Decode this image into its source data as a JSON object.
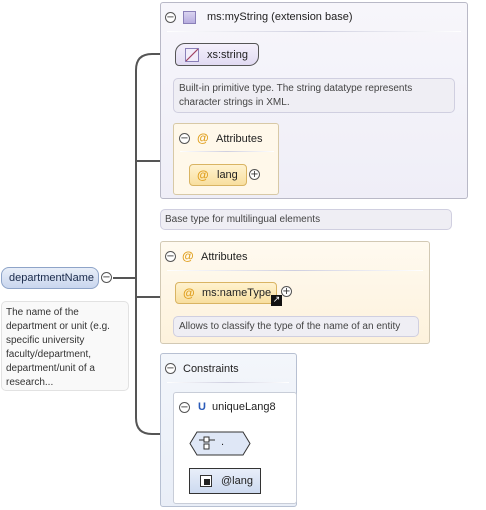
{
  "root": {
    "name": "departmentName",
    "doc": [
      "The name of the",
      "department or unit (e.g.",
      "specific university",
      "faculty/department,",
      "department/unit of a",
      "research..."
    ]
  },
  "type_box": {
    "title": "ms:myString (extension base)",
    "base_type": "xs:string",
    "base_doc": [
      "Built-in primitive type. The string datatype represents",
      "character strings in XML."
    ],
    "attributes_title": "Attributes",
    "attribute": "lang",
    "type_doc": "Base type for multilingual elements"
  },
  "attributes_box": {
    "title": "Attributes",
    "attribute": "ms:nameType",
    "attribute_doc": "Allows to classify the type of the name of an entity"
  },
  "constraints_box": {
    "title": "Constraints",
    "key_letter": "U",
    "unique_name": "uniqueLang8",
    "selector": ".",
    "field": "@lang"
  },
  "colors": {
    "attr_at": "#e0a020",
    "unique_letter": "#2a5ab8",
    "wire": "#555555"
  }
}
